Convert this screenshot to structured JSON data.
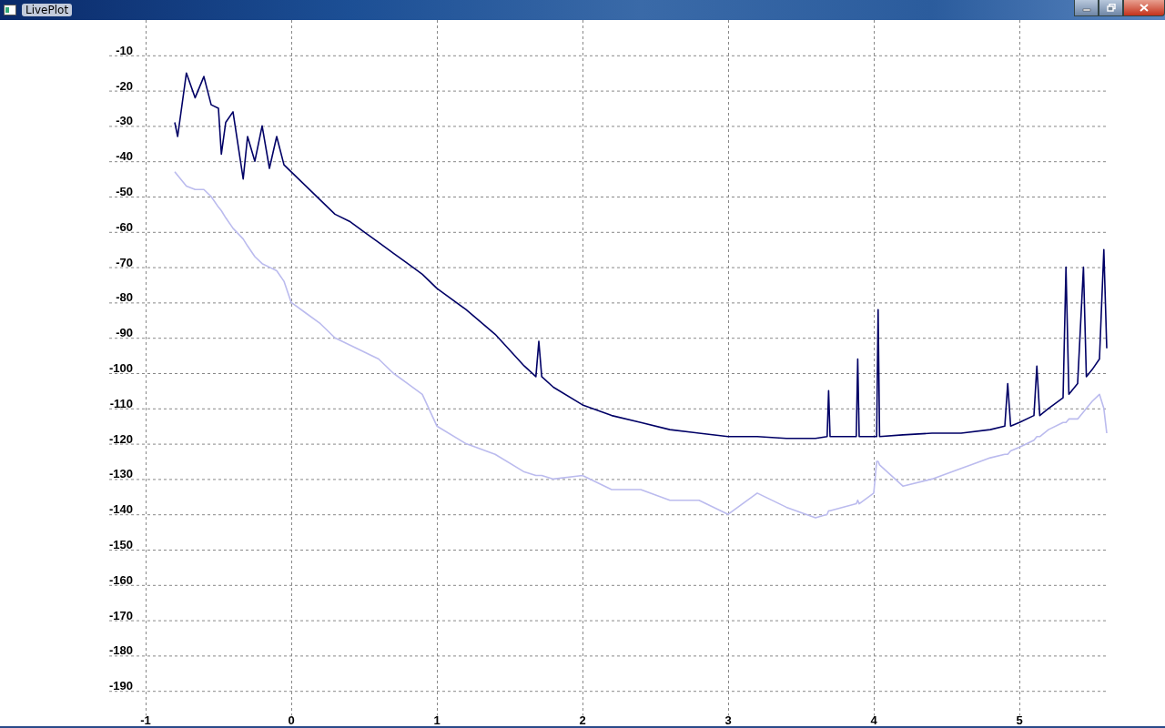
{
  "window": {
    "title": "LivePlot"
  },
  "chart_data": {
    "type": "line",
    "x": [
      -0.8,
      -0.78,
      -0.72,
      -0.66,
      -0.6,
      -0.55,
      -0.5,
      -0.48,
      -0.45,
      -0.4,
      -0.33,
      -0.3,
      -0.25,
      -0.2,
      -0.15,
      -0.1,
      -0.05,
      0,
      0.1,
      0.2,
      0.3,
      0.4,
      0.5,
      0.6,
      0.7,
      0.8,
      0.9,
      1,
      1.2,
      1.4,
      1.6,
      1.68,
      1.7,
      1.72,
      1.8,
      2,
      2.2,
      2.4,
      2.6,
      2.8,
      3,
      3.2,
      3.4,
      3.6,
      3.68,
      3.69,
      3.7,
      3.88,
      3.89,
      3.9,
      4,
      4.02,
      4.03,
      4.04,
      4.2,
      4.4,
      4.6,
      4.8,
      4.9,
      4.92,
      4.94,
      5,
      5.1,
      5.12,
      5.14,
      5.2,
      5.3,
      5.32,
      5.34,
      5.4,
      5.44,
      5.46,
      5.5,
      5.55,
      5.58,
      5.6
    ],
    "series": [
      {
        "color": "#000066",
        "values": [
          -29,
          -33,
          -15,
          -22,
          -16,
          -24,
          -25,
          -38,
          -29,
          -26,
          -45,
          -33,
          -40,
          -30,
          -42,
          -33,
          -41,
          -43,
          -47,
          -51,
          -55,
          -57,
          -60,
          -63,
          -66,
          -69,
          -72,
          -76,
          -82,
          -89,
          -98,
          -101,
          -91,
          -101,
          -104,
          -109,
          -112,
          -114,
          -116,
          -117,
          -118,
          -118,
          -118.5,
          -118.5,
          -118,
          -105,
          -118,
          -118,
          -96,
          -118,
          -118,
          -118,
          -82,
          -118,
          -117.5,
          -117,
          -117,
          -116,
          -115,
          -103,
          -115,
          -114,
          -112,
          -98,
          -112,
          -110,
          -107,
          -70,
          -106,
          -103,
          -70,
          -101,
          -99,
          -96,
          -65,
          -93
        ]
      },
      {
        "color": "#bbbbee",
        "values": [
          -43,
          -44,
          -47,
          -48,
          -48,
          -50,
          -53,
          -54,
          -56,
          -59,
          -62,
          -64,
          -67,
          -69,
          -70,
          -71,
          -74,
          -80,
          -83,
          -86,
          -90,
          -92,
          -94,
          -96,
          -100,
          -103,
          -106,
          -115,
          -120,
          -123,
          -128,
          -129,
          -129,
          -129,
          -130,
          -129,
          -133,
          -133,
          -136,
          -136,
          -140,
          -134,
          -138,
          -141,
          -140,
          -139,
          -139,
          -137,
          -136,
          -137,
          -134,
          -125,
          -125,
          -126,
          -132,
          -130,
          -127,
          -124,
          -123,
          -123,
          -122,
          -121,
          -119,
          -118,
          -118,
          -116,
          -114,
          -114,
          -113,
          -113,
          -111,
          -110,
          -108,
          -106,
          -110,
          -117
        ]
      }
    ],
    "xlim": [
      -1.25,
      5.6
    ],
    "ylim": [
      -197,
      0
    ],
    "grid": true,
    "xticks": [
      -1,
      0,
      1,
      2,
      3,
      4,
      5
    ],
    "yticks": [
      -10,
      -20,
      -30,
      -40,
      -50,
      -60,
      -70,
      -80,
      -90,
      -100,
      -110,
      -120,
      -130,
      -140,
      -150,
      -160,
      -170,
      -180,
      -190
    ]
  }
}
